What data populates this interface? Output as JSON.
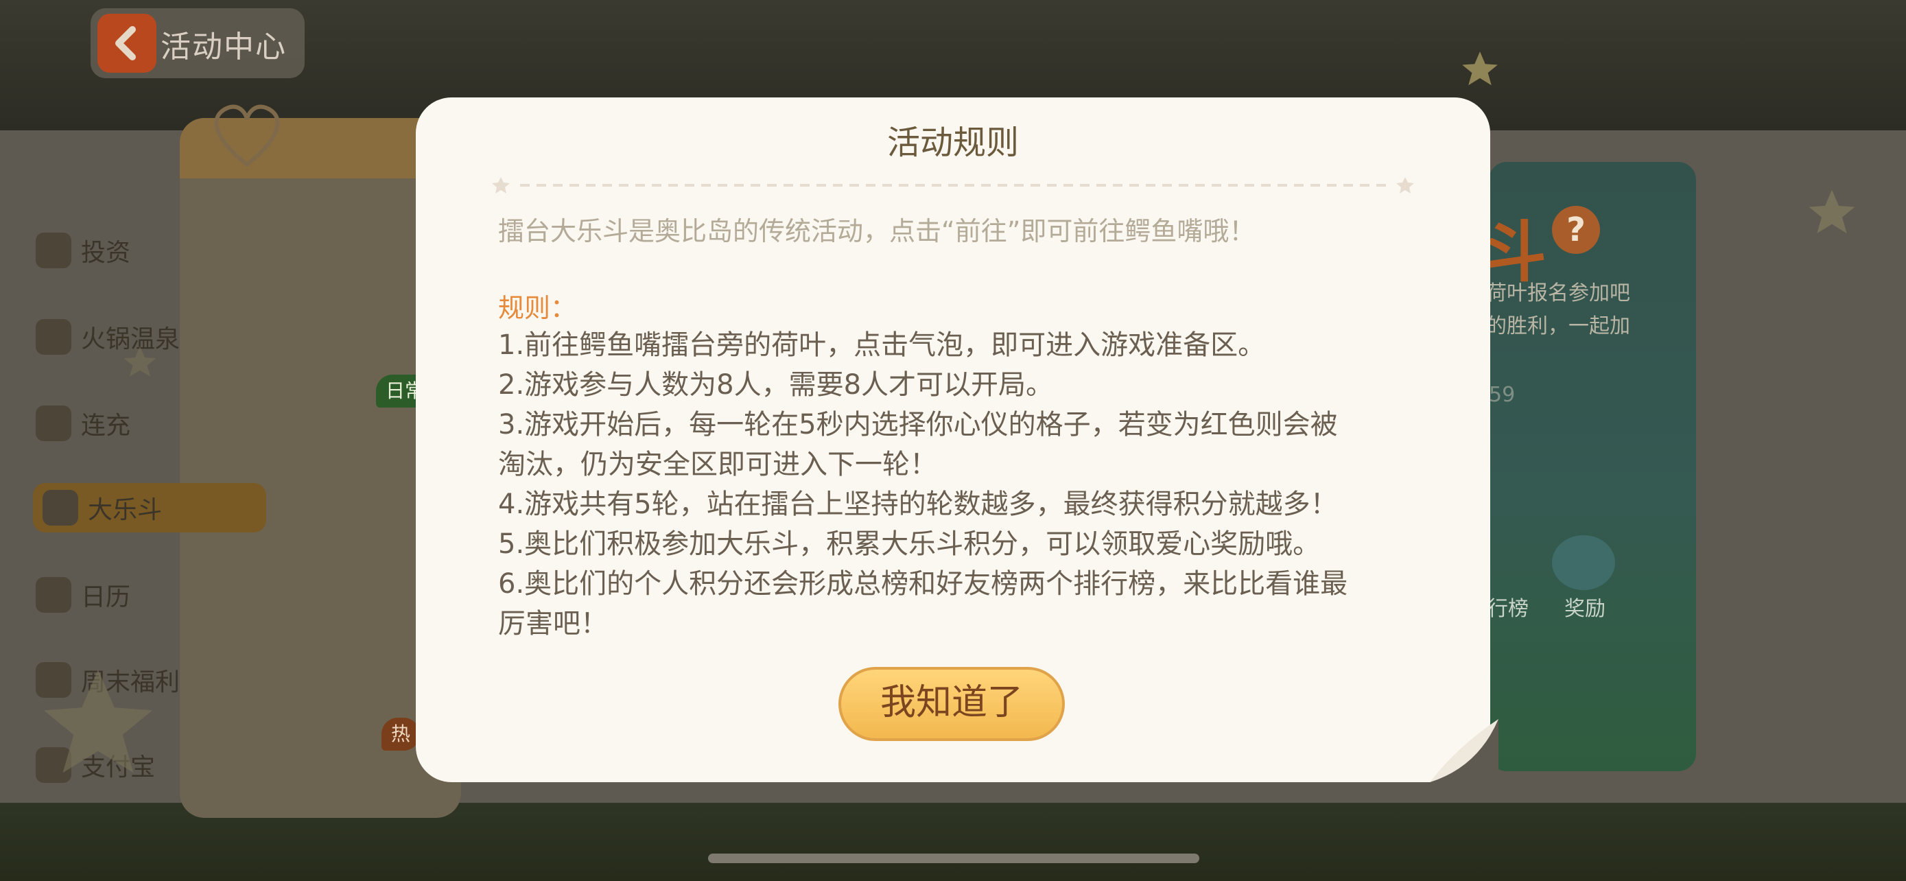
{
  "nav": {
    "back_label": "活动中心"
  },
  "sidebar": {
    "items": [
      {
        "label": "投资",
        "icon": "bar-chart-icon"
      },
      {
        "label": "火锅温泉",
        "icon": "hotpot-icon"
      },
      {
        "label": "连充",
        "icon": "coin-icon",
        "badge": "日常"
      },
      {
        "label": "大乐斗",
        "icon": "crocodile-icon",
        "active": true
      },
      {
        "label": "日历",
        "icon": "calendar-icon"
      },
      {
        "label": "周末福利",
        "icon": "gift-icon"
      },
      {
        "label": "支付宝",
        "icon": "alipay-icon",
        "badge": "热"
      }
    ]
  },
  "game_card": {
    "title_fragment": "斗",
    "desc_line1": "荷叶报名参加吧",
    "desc_line2": "的胜利，一起加",
    "countdown": "59",
    "rank_label": "行榜",
    "reward_label": "奖励"
  },
  "modal": {
    "title": "活动规则",
    "intro": "擂台大乐斗是奥比岛的传统活动，点击“前往”即可前往鳄鱼嘴哦！",
    "rules_heading": "规则：",
    "rules": [
      "1.前往鳄鱼嘴擂台旁的荷叶，点击气泡，即可进入游戏准备区。",
      "2.游戏参与人数为8人，需要8人才可以开局。",
      "3.游戏开始后，每一轮在5秒内选择你心仪的格子，若变为红色则会被",
      "淘汰，仍为安全区即可进入下一轮！",
      "4.游戏共有5轮，站在擂台上坚持的轮数越多，最终获得积分就越多！",
      "5.奥比们积极参加大乐斗，积累大乐斗积分，可以领取爱心奖励哦。",
      "6.奥比们的个人积分还会形成总榜和好友榜两个排行榜，来比比看谁最",
      "厉害吧！"
    ],
    "confirm_label": "我知道了"
  },
  "colors": {
    "accent_orange": "#e68a3c",
    "button_yellow": "#f3b84f",
    "modal_bg": "#fbf8f1"
  }
}
